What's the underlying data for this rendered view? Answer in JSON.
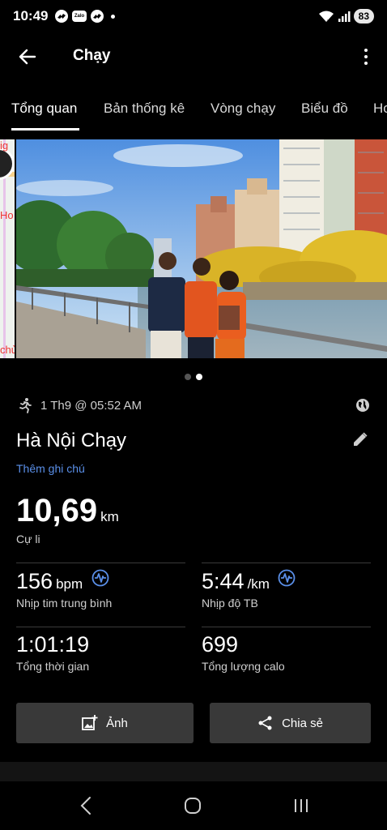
{
  "status_bar": {
    "time": "10:49",
    "apps": [
      "messenger-icon",
      "zalo-icon",
      "messenger-icon"
    ],
    "zalo_text": "Zalo",
    "battery": "83"
  },
  "app_bar": {
    "title": "Chạy"
  },
  "tabs": [
    {
      "label": "Tổng quan",
      "active": true
    },
    {
      "label": "Bản thống kê",
      "active": false
    },
    {
      "label": "Vòng chạy",
      "active": false
    },
    {
      "label": "Biểu đồ",
      "active": false
    },
    {
      "label": "Ho",
      "active": false
    }
  ],
  "map_labels": [
    "ig",
    "Ho",
    "chủ"
  ],
  "carousel": {
    "count": 2,
    "active_index": 1
  },
  "activity": {
    "date": "1 Th9 @ 05:52 AM",
    "name": "Hà Nội Chạy",
    "add_note": "Thêm ghi chú",
    "distance_value": "10,69",
    "distance_unit": "km",
    "distance_label": "Cự li"
  },
  "stats": [
    {
      "value": "156",
      "unit": "bpm",
      "label": "Nhịp tim trung bình",
      "icon": "heart-rate-icon"
    },
    {
      "value": "5:44",
      "unit": "/km",
      "label": "Nhịp độ TB",
      "icon": "heart-rate-icon"
    },
    {
      "value": "1:01:19",
      "unit": "",
      "label": "Tổng thời gian"
    },
    {
      "value": "699",
      "unit": "",
      "label": "Tổng lượng calo"
    }
  ],
  "buttons": {
    "photo": "Ảnh",
    "share": "Chia sẻ"
  },
  "colors": {
    "accent_blue": "#5a8fe8",
    "background": "#000000",
    "button_bg": "#393939"
  }
}
